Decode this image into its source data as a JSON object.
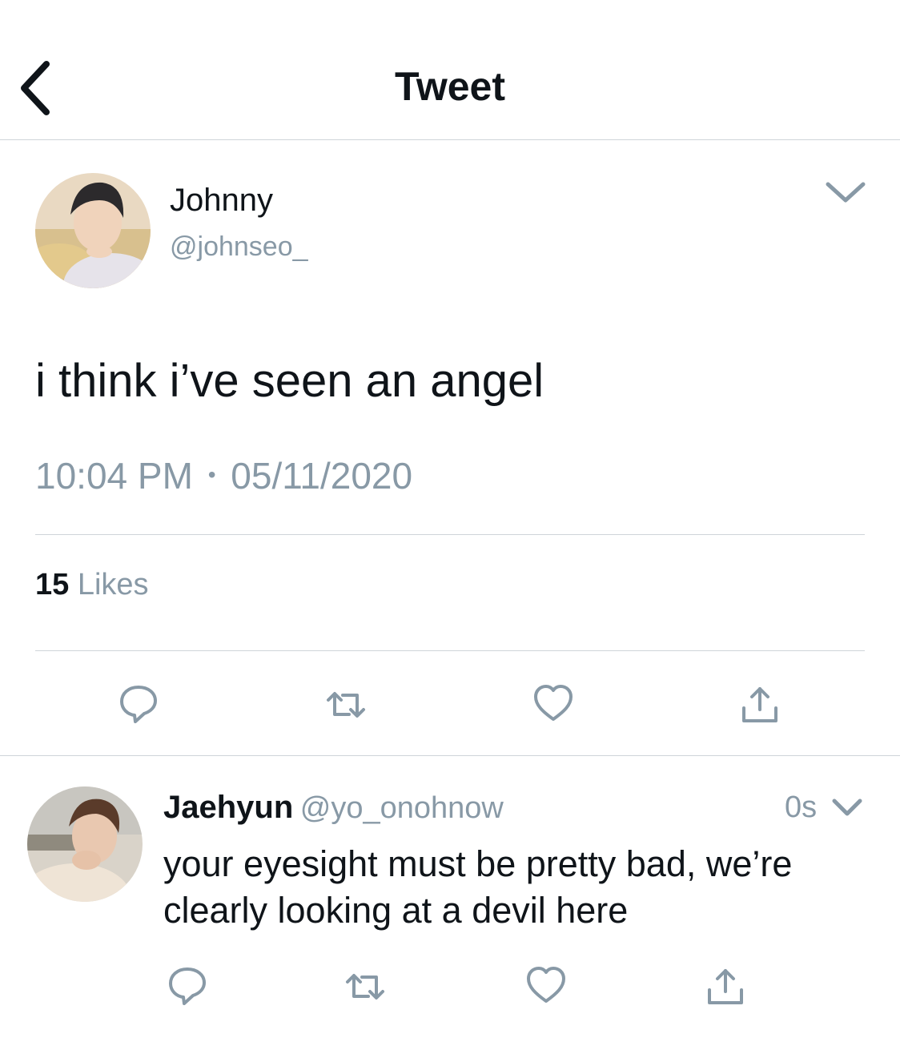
{
  "header": {
    "title": "Tweet",
    "back_icon": "chevron-left-icon"
  },
  "tweet": {
    "author_name": "Johnny",
    "author_handle": "@johnseo_",
    "text": "i think i’ve seen an angel",
    "time": "10:04 PM",
    "separator": "•",
    "date": "05/11/2020",
    "likes_count": "15",
    "likes_label": "Likes",
    "menu_icon": "chevron-down-icon",
    "actions": [
      "reply-icon",
      "retweet-icon",
      "like-icon",
      "share-icon"
    ]
  },
  "reply": {
    "author_name": "Jaehyun",
    "author_handle": "@yo_onohnow",
    "time": "0s",
    "text_line1": "your eyesight must be pretty bad, we’re",
    "text_line2": "clearly looking at a devil here",
    "menu_icon": "chevron-down-icon",
    "actions": [
      "reply-icon",
      "retweet-icon",
      "like-icon",
      "share-icon"
    ]
  },
  "colors": {
    "text": "#0f1419",
    "secondary": "#8899a6",
    "divider": "#cfd4d9"
  }
}
